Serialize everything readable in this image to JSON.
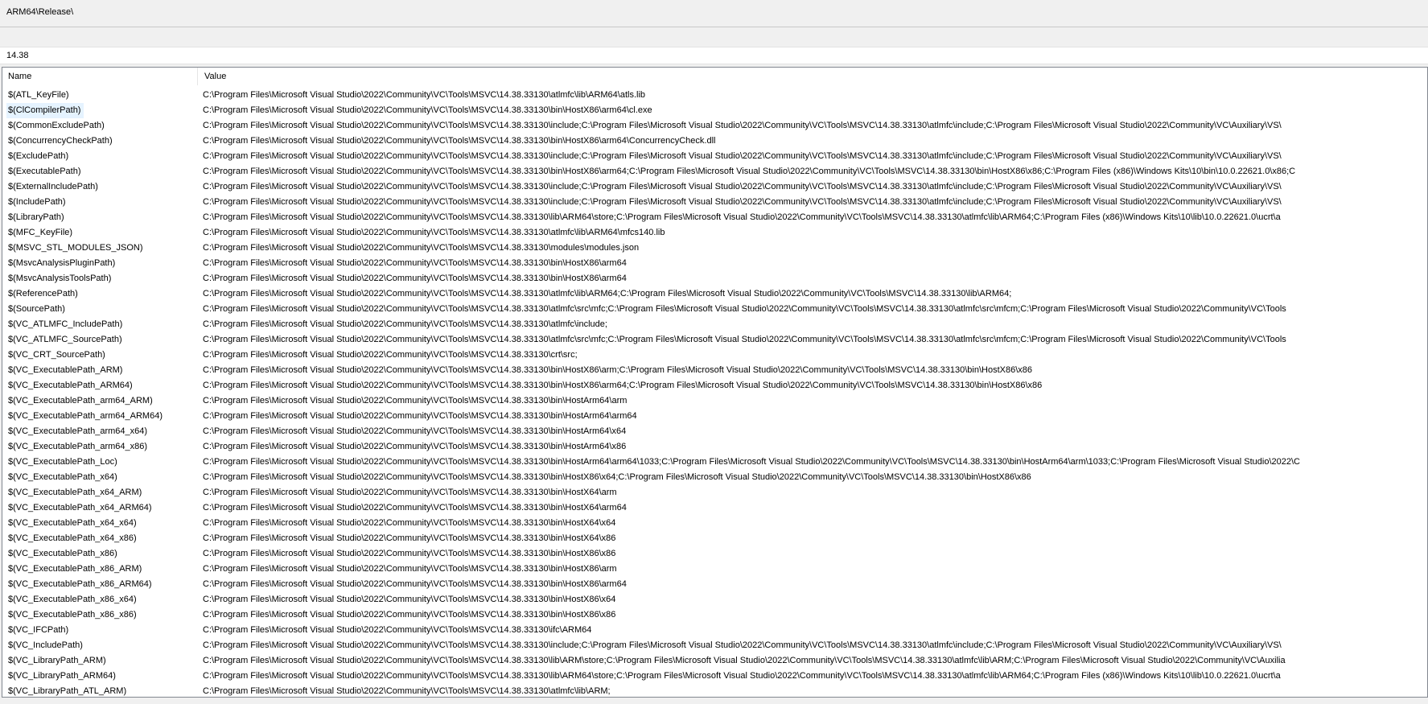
{
  "evaluated_value": "ARM64\\Release\\",
  "filter": {
    "value": "14.38"
  },
  "columns": {
    "name": "Name",
    "value": "Value"
  },
  "macros": [
    {
      "name": "$(ATL_KeyFile)",
      "value": "C:\\Program Files\\Microsoft Visual Studio\\2022\\Community\\VC\\Tools\\MSVC\\14.38.33130\\atlmfc\\lib\\ARM64\\atls.lib"
    },
    {
      "name": "$(ClCompilerPath)",
      "value": "C:\\Program Files\\Microsoft Visual Studio\\2022\\Community\\VC\\Tools\\MSVC\\14.38.33130\\bin\\HostX86\\arm64\\cl.exe"
    },
    {
      "name": "$(CommonExcludePath)",
      "value": "C:\\Program Files\\Microsoft Visual Studio\\2022\\Community\\VC\\Tools\\MSVC\\14.38.33130\\include;C:\\Program Files\\Microsoft Visual Studio\\2022\\Community\\VC\\Tools\\MSVC\\14.38.33130\\atlmfc\\include;C:\\Program Files\\Microsoft Visual Studio\\2022\\Community\\VC\\Auxiliary\\VS\\"
    },
    {
      "name": "$(ConcurrencyCheckPath)",
      "value": "C:\\Program Files\\Microsoft Visual Studio\\2022\\Community\\VC\\Tools\\MSVC\\14.38.33130\\bin\\HostX86\\arm64\\ConcurrencyCheck.dll"
    },
    {
      "name": "$(ExcludePath)",
      "value": "C:\\Program Files\\Microsoft Visual Studio\\2022\\Community\\VC\\Tools\\MSVC\\14.38.33130\\include;C:\\Program Files\\Microsoft Visual Studio\\2022\\Community\\VC\\Tools\\MSVC\\14.38.33130\\atlmfc\\include;C:\\Program Files\\Microsoft Visual Studio\\2022\\Community\\VC\\Auxiliary\\VS\\"
    },
    {
      "name": "$(ExecutablePath)",
      "value": "C:\\Program Files\\Microsoft Visual Studio\\2022\\Community\\VC\\Tools\\MSVC\\14.38.33130\\bin\\HostX86\\arm64;C:\\Program Files\\Microsoft Visual Studio\\2022\\Community\\VC\\Tools\\MSVC\\14.38.33130\\bin\\HostX86\\x86;C:\\Program Files (x86)\\Windows Kits\\10\\bin\\10.0.22621.0\\x86;C"
    },
    {
      "name": "$(ExternalIncludePath)",
      "value": "C:\\Program Files\\Microsoft Visual Studio\\2022\\Community\\VC\\Tools\\MSVC\\14.38.33130\\include;C:\\Program Files\\Microsoft Visual Studio\\2022\\Community\\VC\\Tools\\MSVC\\14.38.33130\\atlmfc\\include;C:\\Program Files\\Microsoft Visual Studio\\2022\\Community\\VC\\Auxiliary\\VS\\"
    },
    {
      "name": "$(IncludePath)",
      "value": "C:\\Program Files\\Microsoft Visual Studio\\2022\\Community\\VC\\Tools\\MSVC\\14.38.33130\\include;C:\\Program Files\\Microsoft Visual Studio\\2022\\Community\\VC\\Tools\\MSVC\\14.38.33130\\atlmfc\\include;C:\\Program Files\\Microsoft Visual Studio\\2022\\Community\\VC\\Auxiliary\\VS\\"
    },
    {
      "name": "$(LibraryPath)",
      "value": "C:\\Program Files\\Microsoft Visual Studio\\2022\\Community\\VC\\Tools\\MSVC\\14.38.33130\\lib\\ARM64\\store;C:\\Program Files\\Microsoft Visual Studio\\2022\\Community\\VC\\Tools\\MSVC\\14.38.33130\\atlmfc\\lib\\ARM64;C:\\Program Files (x86)\\Windows Kits\\10\\lib\\10.0.22621.0\\ucrt\\a"
    },
    {
      "name": "$(MFC_KeyFile)",
      "value": "C:\\Program Files\\Microsoft Visual Studio\\2022\\Community\\VC\\Tools\\MSVC\\14.38.33130\\atlmfc\\lib\\ARM64\\mfcs140.lib"
    },
    {
      "name": "$(MSVC_STL_MODULES_JSON)",
      "value": "C:\\Program Files\\Microsoft Visual Studio\\2022\\Community\\VC\\Tools\\MSVC\\14.38.33130\\modules\\modules.json"
    },
    {
      "name": "$(MsvcAnalysisPluginPath)",
      "value": "C:\\Program Files\\Microsoft Visual Studio\\2022\\Community\\VC\\Tools\\MSVC\\14.38.33130\\bin\\HostX86\\arm64"
    },
    {
      "name": "$(MsvcAnalysisToolsPath)",
      "value": "C:\\Program Files\\Microsoft Visual Studio\\2022\\Community\\VC\\Tools\\MSVC\\14.38.33130\\bin\\HostX86\\arm64"
    },
    {
      "name": "$(ReferencePath)",
      "value": "C:\\Program Files\\Microsoft Visual Studio\\2022\\Community\\VC\\Tools\\MSVC\\14.38.33130\\atlmfc\\lib\\ARM64;C:\\Program Files\\Microsoft Visual Studio\\2022\\Community\\VC\\Tools\\MSVC\\14.38.33130\\lib\\ARM64;"
    },
    {
      "name": "$(SourcePath)",
      "value": "C:\\Program Files\\Microsoft Visual Studio\\2022\\Community\\VC\\Tools\\MSVC\\14.38.33130\\atlmfc\\src\\mfc;C:\\Program Files\\Microsoft Visual Studio\\2022\\Community\\VC\\Tools\\MSVC\\14.38.33130\\atlmfc\\src\\mfcm;C:\\Program Files\\Microsoft Visual Studio\\2022\\Community\\VC\\Tools"
    },
    {
      "name": "$(VC_ATLMFC_IncludePath)",
      "value": "C:\\Program Files\\Microsoft Visual Studio\\2022\\Community\\VC\\Tools\\MSVC\\14.38.33130\\atlmfc\\include;"
    },
    {
      "name": "$(VC_ATLMFC_SourcePath)",
      "value": "C:\\Program Files\\Microsoft Visual Studio\\2022\\Community\\VC\\Tools\\MSVC\\14.38.33130\\atlmfc\\src\\mfc;C:\\Program Files\\Microsoft Visual Studio\\2022\\Community\\VC\\Tools\\MSVC\\14.38.33130\\atlmfc\\src\\mfcm;C:\\Program Files\\Microsoft Visual Studio\\2022\\Community\\VC\\Tools"
    },
    {
      "name": "$(VC_CRT_SourcePath)",
      "value": "C:\\Program Files\\Microsoft Visual Studio\\2022\\Community\\VC\\Tools\\MSVC\\14.38.33130\\crt\\src;"
    },
    {
      "name": "$(VC_ExecutablePath_ARM)",
      "value": "C:\\Program Files\\Microsoft Visual Studio\\2022\\Community\\VC\\Tools\\MSVC\\14.38.33130\\bin\\HostX86\\arm;C:\\Program Files\\Microsoft Visual Studio\\2022\\Community\\VC\\Tools\\MSVC\\14.38.33130\\bin\\HostX86\\x86"
    },
    {
      "name": "$(VC_ExecutablePath_ARM64)",
      "value": "C:\\Program Files\\Microsoft Visual Studio\\2022\\Community\\VC\\Tools\\MSVC\\14.38.33130\\bin\\HostX86\\arm64;C:\\Program Files\\Microsoft Visual Studio\\2022\\Community\\VC\\Tools\\MSVC\\14.38.33130\\bin\\HostX86\\x86"
    },
    {
      "name": "$(VC_ExecutablePath_arm64_ARM)",
      "value": "C:\\Program Files\\Microsoft Visual Studio\\2022\\Community\\VC\\Tools\\MSVC\\14.38.33130\\bin\\HostArm64\\arm"
    },
    {
      "name": "$(VC_ExecutablePath_arm64_ARM64)",
      "value": "C:\\Program Files\\Microsoft Visual Studio\\2022\\Community\\VC\\Tools\\MSVC\\14.38.33130\\bin\\HostArm64\\arm64"
    },
    {
      "name": "$(VC_ExecutablePath_arm64_x64)",
      "value": "C:\\Program Files\\Microsoft Visual Studio\\2022\\Community\\VC\\Tools\\MSVC\\14.38.33130\\bin\\HostArm64\\x64"
    },
    {
      "name": "$(VC_ExecutablePath_arm64_x86)",
      "value": "C:\\Program Files\\Microsoft Visual Studio\\2022\\Community\\VC\\Tools\\MSVC\\14.38.33130\\bin\\HostArm64\\x86"
    },
    {
      "name": "$(VC_ExecutablePath_Loc)",
      "value": "C:\\Program Files\\Microsoft Visual Studio\\2022\\Community\\VC\\Tools\\MSVC\\14.38.33130\\bin\\HostArm64\\arm64\\1033;C:\\Program Files\\Microsoft Visual Studio\\2022\\Community\\VC\\Tools\\MSVC\\14.38.33130\\bin\\HostArm64\\arm\\1033;C:\\Program Files\\Microsoft Visual Studio\\2022\\C"
    },
    {
      "name": "$(VC_ExecutablePath_x64)",
      "value": "C:\\Program Files\\Microsoft Visual Studio\\2022\\Community\\VC\\Tools\\MSVC\\14.38.33130\\bin\\HostX86\\x64;C:\\Program Files\\Microsoft Visual Studio\\2022\\Community\\VC\\Tools\\MSVC\\14.38.33130\\bin\\HostX86\\x86"
    },
    {
      "name": "$(VC_ExecutablePath_x64_ARM)",
      "value": "C:\\Program Files\\Microsoft Visual Studio\\2022\\Community\\VC\\Tools\\MSVC\\14.38.33130\\bin\\HostX64\\arm"
    },
    {
      "name": "$(VC_ExecutablePath_x64_ARM64)",
      "value": "C:\\Program Files\\Microsoft Visual Studio\\2022\\Community\\VC\\Tools\\MSVC\\14.38.33130\\bin\\HostX64\\arm64"
    },
    {
      "name": "$(VC_ExecutablePath_x64_x64)",
      "value": "C:\\Program Files\\Microsoft Visual Studio\\2022\\Community\\VC\\Tools\\MSVC\\14.38.33130\\bin\\HostX64\\x64"
    },
    {
      "name": "$(VC_ExecutablePath_x64_x86)",
      "value": "C:\\Program Files\\Microsoft Visual Studio\\2022\\Community\\VC\\Tools\\MSVC\\14.38.33130\\bin\\HostX64\\x86"
    },
    {
      "name": "$(VC_ExecutablePath_x86)",
      "value": "C:\\Program Files\\Microsoft Visual Studio\\2022\\Community\\VC\\Tools\\MSVC\\14.38.33130\\bin\\HostX86\\x86"
    },
    {
      "name": "$(VC_ExecutablePath_x86_ARM)",
      "value": "C:\\Program Files\\Microsoft Visual Studio\\2022\\Community\\VC\\Tools\\MSVC\\14.38.33130\\bin\\HostX86\\arm"
    },
    {
      "name": "$(VC_ExecutablePath_x86_ARM64)",
      "value": "C:\\Program Files\\Microsoft Visual Studio\\2022\\Community\\VC\\Tools\\MSVC\\14.38.33130\\bin\\HostX86\\arm64"
    },
    {
      "name": "$(VC_ExecutablePath_x86_x64)",
      "value": "C:\\Program Files\\Microsoft Visual Studio\\2022\\Community\\VC\\Tools\\MSVC\\14.38.33130\\bin\\HostX86\\x64"
    },
    {
      "name": "$(VC_ExecutablePath_x86_x86)",
      "value": "C:\\Program Files\\Microsoft Visual Studio\\2022\\Community\\VC\\Tools\\MSVC\\14.38.33130\\bin\\HostX86\\x86"
    },
    {
      "name": "$(VC_IFCPath)",
      "value": "C:\\Program Files\\Microsoft Visual Studio\\2022\\Community\\VC\\Tools\\MSVC\\14.38.33130\\ifc\\ARM64"
    },
    {
      "name": "$(VC_IncludePath)",
      "value": "C:\\Program Files\\Microsoft Visual Studio\\2022\\Community\\VC\\Tools\\MSVC\\14.38.33130\\include;C:\\Program Files\\Microsoft Visual Studio\\2022\\Community\\VC\\Tools\\MSVC\\14.38.33130\\atlmfc\\include;C:\\Program Files\\Microsoft Visual Studio\\2022\\Community\\VC\\Auxiliary\\VS\\"
    },
    {
      "name": "$(VC_LibraryPath_ARM)",
      "value": "C:\\Program Files\\Microsoft Visual Studio\\2022\\Community\\VC\\Tools\\MSVC\\14.38.33130\\lib\\ARM\\store;C:\\Program Files\\Microsoft Visual Studio\\2022\\Community\\VC\\Tools\\MSVC\\14.38.33130\\atlmfc\\lib\\ARM;C:\\Program Files\\Microsoft Visual Studio\\2022\\Community\\VC\\Auxilia"
    },
    {
      "name": "$(VC_LibraryPath_ARM64)",
      "value": "C:\\Program Files\\Microsoft Visual Studio\\2022\\Community\\VC\\Tools\\MSVC\\14.38.33130\\lib\\ARM64\\store;C:\\Program Files\\Microsoft Visual Studio\\2022\\Community\\VC\\Tools\\MSVC\\14.38.33130\\atlmfc\\lib\\ARM64;C:\\Program Files (x86)\\Windows Kits\\10\\lib\\10.0.22621.0\\ucrt\\a"
    },
    {
      "name": "$(VC_LibraryPath_ATL_ARM)",
      "value": "C:\\Program Files\\Microsoft Visual Studio\\2022\\Community\\VC\\Tools\\MSVC\\14.38.33130\\atlmfc\\lib\\ARM;"
    }
  ]
}
